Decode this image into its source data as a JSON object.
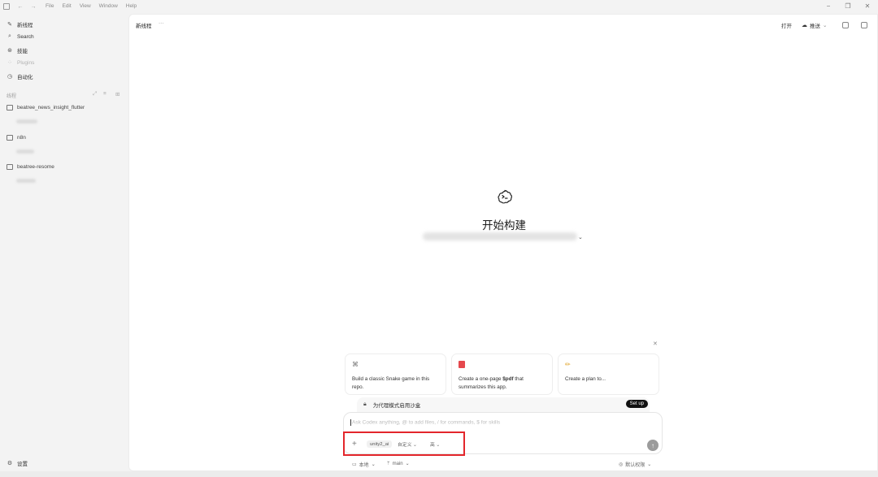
{
  "menu": [
    "File",
    "Edit",
    "View",
    "Window",
    "Help"
  ],
  "sidebar": {
    "nav": [
      {
        "label": "新线程",
        "icon": "new-thread-icon",
        "glyph": "✎",
        "disabled": false
      },
      {
        "label": "Search",
        "icon": "search-icon",
        "glyph": "⌕",
        "disabled": false
      },
      {
        "label": "技能",
        "icon": "skills-icon",
        "glyph": "⊛",
        "disabled": false
      },
      {
        "label": "Plugins",
        "icon": "plugins-icon",
        "glyph": "⁘",
        "disabled": true
      },
      {
        "label": "自动化",
        "icon": "clock-icon",
        "glyph": "◷",
        "disabled": false
      }
    ],
    "threads_title": "线程",
    "projects": [
      "beatree_news_insight_flutter",
      "n8n",
      "beatree-resome"
    ],
    "settings_label": "设置"
  },
  "header": {
    "title": "新线程",
    "more": "···",
    "open_label": "打开",
    "push_label": "推送"
  },
  "hero": {
    "title": "开始构建"
  },
  "suggestions": [
    {
      "icon": "gamepad-icon",
      "glyph": "🎮",
      "text": "Build a classic Snake game in this repo."
    },
    {
      "icon": "pdf-icon",
      "glyph": "■",
      "text_pre": "Create a one-page ",
      "text_bold": "$pdf",
      "text_post": " that summarizes this app."
    },
    {
      "icon": "pencil-icon",
      "glyph": "✏",
      "text": "Create a plan to..."
    }
  ],
  "sandbox": {
    "text": "为代理模式启用沙盒",
    "button": "Set up"
  },
  "composer": {
    "placeholder": "Ask Codex anything, @ to add files, / for commands, $ for skills",
    "model": "unity2_ai",
    "mode": "自定义",
    "level": "高"
  },
  "footer": {
    "local": "本地",
    "branch": "main",
    "permission": "默认权限"
  },
  "colors": {
    "highlight": "#e3262b",
    "setup_button": "#111111"
  }
}
